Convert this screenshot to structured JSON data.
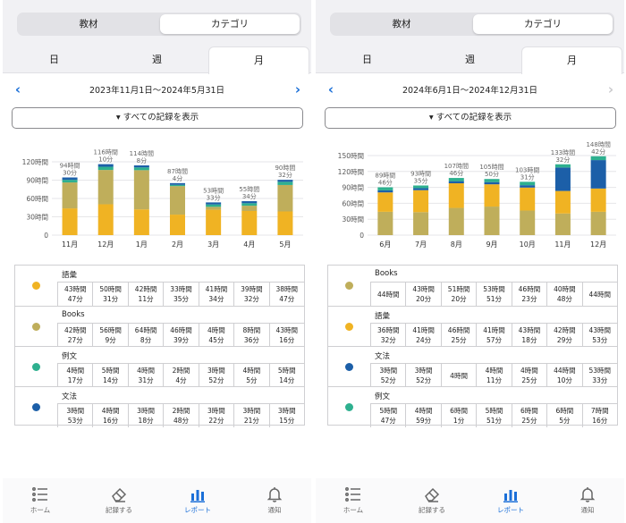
{
  "left": {
    "segment": {
      "materials": "教材",
      "category": "カテゴリ",
      "active": "category"
    },
    "period_tabs": {
      "day": "日",
      "week": "週",
      "month": "月",
      "active": "month"
    },
    "date_range": "2023年11月1日～2024年5月31日",
    "prev_arrow": "‹",
    "next_arrow": "›",
    "show_all_label": "▾ すべての記録を表示",
    "chart_data": {
      "type": "bar",
      "stacked": true,
      "yaxis_ticks": [
        "0",
        "30時間",
        "60時間",
        "90時間",
        "120時間"
      ],
      "ylim": [
        0,
        120
      ],
      "categories": [
        "11月",
        "12月",
        "1月",
        "2月",
        "3月",
        "4月",
        "5月"
      ],
      "totals": [
        {
          "hours": "94時間",
          "minutes": "30分"
        },
        {
          "hours": "116時間",
          "minutes": "10分"
        },
        {
          "hours": "114時間",
          "minutes": "8分"
        },
        {
          "hours": "87時間",
          "minutes": "4分"
        },
        {
          "hours": "53時間",
          "minutes": "33分"
        },
        {
          "hours": "55時間",
          "minutes": "34分"
        },
        {
          "hours": "90時間",
          "minutes": "32分"
        }
      ],
      "series": [
        {
          "name": "語彙",
          "color": "#f0b323",
          "values": [
            43.78,
            50.52,
            42.18,
            33.58,
            41.57,
            39.53,
            38.78
          ]
        },
        {
          "name": "Books",
          "color": "#bfae5b",
          "values": [
            42.45,
            56.15,
            64.13,
            46.65,
            4.75,
            8.6,
            43.27
          ]
        },
        {
          "name": "例文",
          "color": "#2eb08f",
          "values": [
            4.28,
            5.23,
            4.52,
            2.07,
            3.87,
            4.08,
            5.23
          ]
        },
        {
          "name": "文法",
          "color": "#1c5fa8",
          "values": [
            3.88,
            4.27,
            3.3,
            2.8,
            3.37,
            3.35,
            3.25
          ]
        }
      ]
    },
    "rows": [
      {
        "name": "語彙",
        "color": "#f0b323",
        "cells": [
          "43時間\n47分",
          "50時間\n31分",
          "42時間\n11分",
          "33時間\n35分",
          "41時間\n34分",
          "39時間\n32分",
          "38時間\n47分"
        ]
      },
      {
        "name": "Books",
        "color": "#bfae5b",
        "cells": [
          "42時間\n27分",
          "56時間\n9分",
          "64時間\n8分",
          "46時間\n39分",
          "4時間\n45分",
          "8時間\n36分",
          "43時間\n16分"
        ]
      },
      {
        "name": "例文",
        "color": "#2eb08f",
        "cells": [
          "4時間\n17分",
          "5時間\n14分",
          "4時間\n31分",
          "2時間\n4分",
          "3時間\n52分",
          "4時間\n5分",
          "5時間\n14分"
        ]
      },
      {
        "name": "文法",
        "color": "#1c5fa8",
        "cells": [
          "3時間\n53分",
          "4時間\n16分",
          "3時間\n18分",
          "2時間\n48分",
          "3時間\n22分",
          "3時間\n21分",
          "3時間\n15分"
        ]
      }
    ],
    "nav": {
      "home": "ホーム",
      "record": "記録する",
      "report": "レポート",
      "notify": "通知",
      "active": "report"
    }
  },
  "right": {
    "segment": {
      "materials": "教材",
      "category": "カテゴリ",
      "active": "category"
    },
    "period_tabs": {
      "day": "日",
      "week": "週",
      "month": "月",
      "active": "month"
    },
    "date_range": "2024年6月1日～2024年12月31日",
    "prev_arrow": "‹",
    "next_arrow": "›",
    "show_all_label": "▾ すべての記録を表示",
    "chart_data": {
      "type": "bar",
      "stacked": true,
      "yaxis_ticks": [
        "0",
        "30時間",
        "60時間",
        "90時間",
        "120時間",
        "150時間"
      ],
      "ylim": [
        0,
        150
      ],
      "categories": [
        "6月",
        "7月",
        "8月",
        "9月",
        "10月",
        "11月",
        "12月"
      ],
      "totals": [
        {
          "hours": "89時間",
          "minutes": "46分"
        },
        {
          "hours": "93時間",
          "minutes": "35分"
        },
        {
          "hours": "107時間",
          "minutes": "46分"
        },
        {
          "hours": "105時間",
          "minutes": "50分"
        },
        {
          "hours": "103時間",
          "minutes": "31分"
        },
        {
          "hours": "133時間",
          "minutes": "32分"
        },
        {
          "hours": "148時間",
          "minutes": "42分"
        }
      ],
      "series": [
        {
          "name": "Books",
          "color": "#bfae5b",
          "values": [
            44,
            43.33,
            51.33,
            53.85,
            46.38,
            40.8,
            44
          ]
        },
        {
          "name": "語彙",
          "color": "#f0b323",
          "values": [
            36.53,
            41.4,
            46.42,
            41.95,
            43.3,
            42.48,
            43.88
          ]
        },
        {
          "name": "文法",
          "color": "#1c5fa8",
          "values": [
            3.87,
            3.87,
            4,
            4.18,
            4.42,
            44.17,
            53.55
          ]
        },
        {
          "name": "例文",
          "color": "#2eb08f",
          "values": [
            5.78,
            4.98,
            6.02,
            5.85,
            6.42,
            6.08,
            7.27
          ]
        }
      ]
    },
    "rows": [
      {
        "name": "Books",
        "color": "#bfae5b",
        "cells": [
          "44時間",
          "43時間\n20分",
          "51時間\n20分",
          "53時間\n51分",
          "46時間\n23分",
          "40時間\n48分",
          "44時間"
        ]
      },
      {
        "name": "語彙",
        "color": "#f0b323",
        "cells": [
          "36時間\n32分",
          "41時間\n24分",
          "46時間\n25分",
          "41時間\n57分",
          "43時間\n18分",
          "42時間\n29分",
          "43時間\n53分"
        ]
      },
      {
        "name": "文法",
        "color": "#1c5fa8",
        "cells": [
          "3時間\n52分",
          "3時間\n52分",
          "4時間",
          "4時間\n11分",
          "4時間\n25分",
          "44時間\n10分",
          "53時間\n33分"
        ]
      },
      {
        "name": "例文",
        "color": "#2eb08f",
        "cells": [
          "5時間\n47分",
          "4時間\n59分",
          "6時間\n1分",
          "5時間\n51分",
          "6時間\n25分",
          "6時間\n5分",
          "7時間\n16分"
        ]
      }
    ],
    "nav": {
      "home": "ホーム",
      "record": "記録する",
      "report": "レポート",
      "notify": "通知",
      "active": "report"
    }
  }
}
